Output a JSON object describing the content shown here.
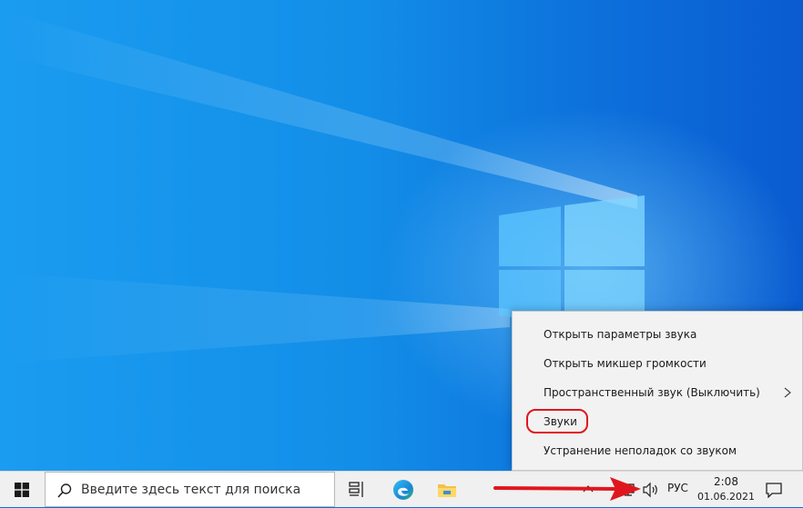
{
  "context_menu": {
    "items": [
      {
        "label": "Открыть параметры звука"
      },
      {
        "label": "Открыть микшер громкости"
      },
      {
        "label": "Пространственный звук (Выключить)",
        "has_submenu": true
      },
      {
        "label": "Звуки",
        "highlighted": true
      },
      {
        "label": "Устранение неполадок со звуком"
      }
    ]
  },
  "taskbar": {
    "search_placeholder": "Введите здесь текст для поиска",
    "pinned": [
      "task-view-icon",
      "edge-icon",
      "file-explorer-icon"
    ],
    "tray": {
      "language": "РУС",
      "time": "2:08",
      "date": "01.06.2021"
    }
  },
  "colors": {
    "annotation_red": "#e0161e",
    "taskbar_bg": "#f0f0f0",
    "menu_bg": "#f2f2f2"
  }
}
